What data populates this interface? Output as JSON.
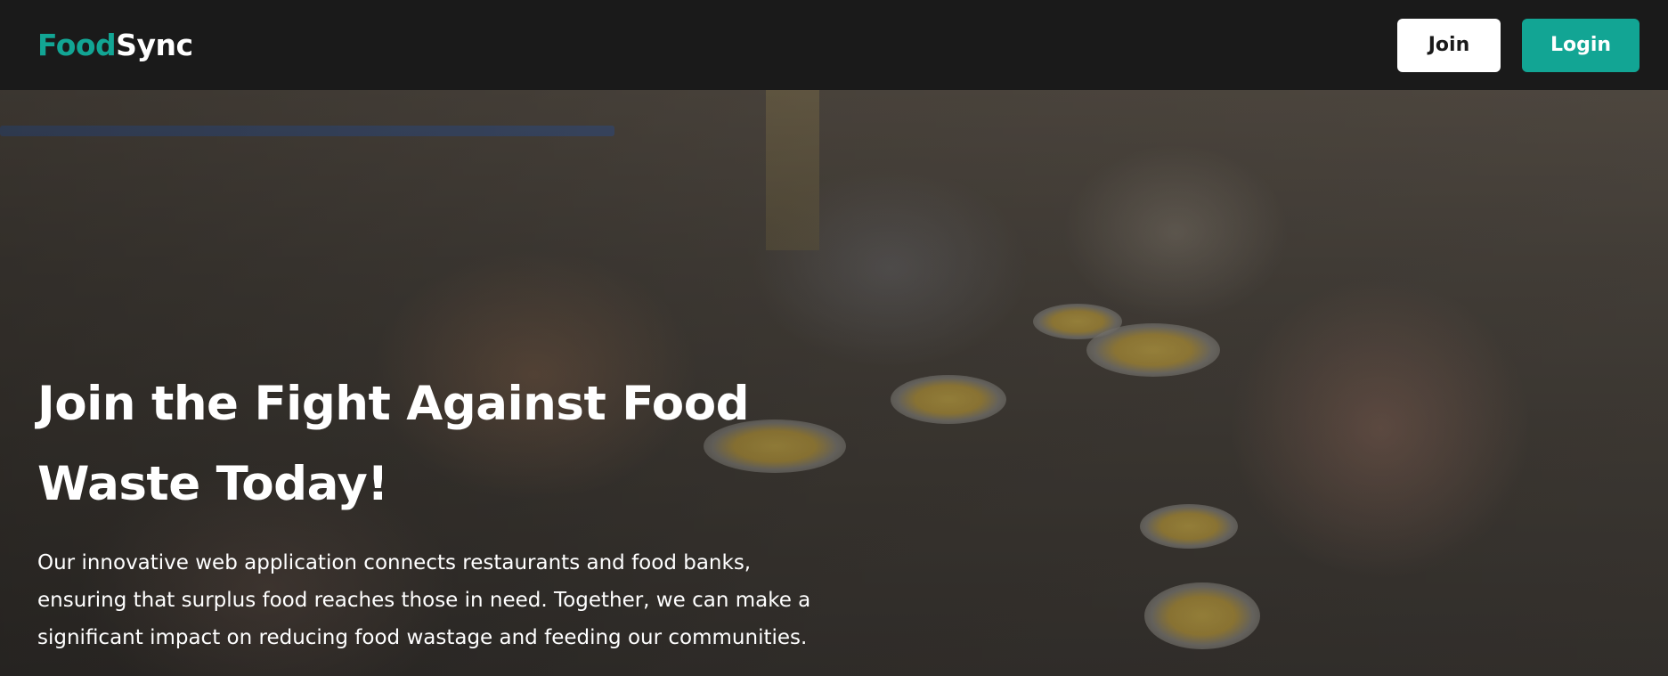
{
  "brand": {
    "name_part1": "Food",
    "name_part2": "Sync",
    "accent_color": "#12a594"
  },
  "nav": {
    "join_label": "Join",
    "login_label": "Login"
  },
  "hero": {
    "image": "children-sharing-meal-photo",
    "title": "Join the Fight Against Food Waste Today!",
    "description": "Our innovative web application connects restaurants and food banks, ensuring that surplus food reaches those in need. Together, we can make a significant impact on reducing food wastage and feeding our communities."
  }
}
